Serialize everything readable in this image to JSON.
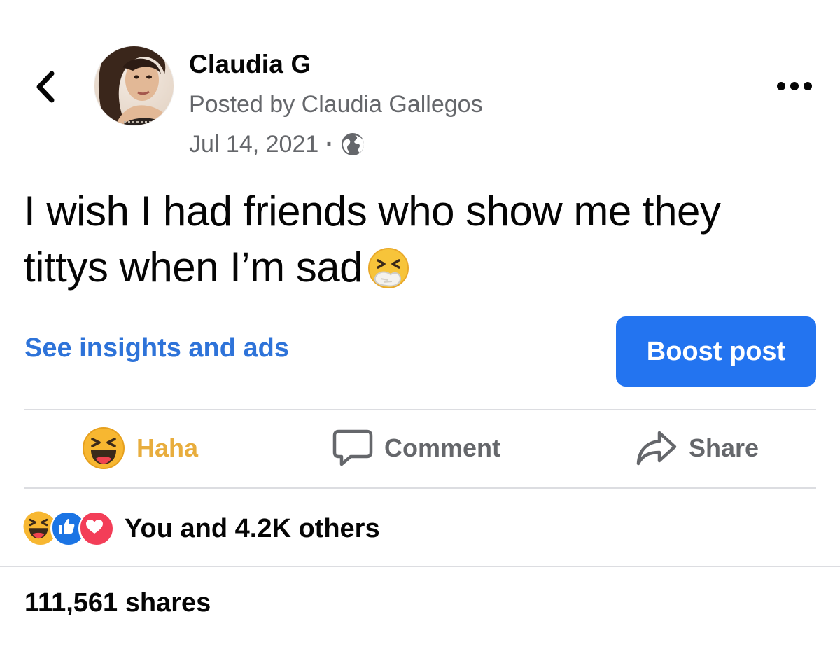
{
  "post": {
    "page_name": "Claudia G",
    "posted_by": "Posted by Claudia Gallegos",
    "date": "Jul 14, 2021",
    "separator": "·",
    "audience_icon": "globe-icon",
    "text": "I wish I had friends who show me they tittys when I’m sad",
    "text_emoji": "sneezing-face-icon"
  },
  "insights": {
    "link_label": "See insights and ads",
    "boost_label": "Boost post"
  },
  "actions": {
    "haha_label": "Haha",
    "comment_label": "Comment",
    "share_label": "Share"
  },
  "summary": {
    "reaction_icons": [
      "haha-icon",
      "like-icon",
      "love-icon"
    ],
    "reactions_text": "You and 4.2K others",
    "shares_text": "111,561 shares"
  },
  "colors": {
    "link_blue": "#2e73d9",
    "boost_blue": "#2374f0",
    "haha_yellow": "#e8ad3d",
    "secondary_text": "#65676b"
  }
}
